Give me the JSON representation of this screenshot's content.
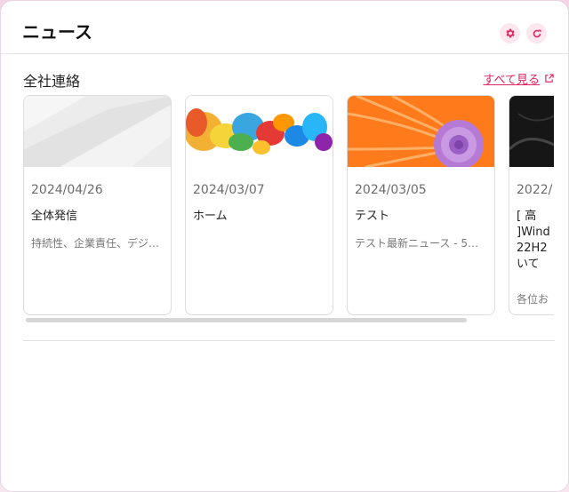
{
  "header": {
    "title": "ニュース",
    "settings_icon": "gear-icon",
    "refresh_icon": "refresh-icon"
  },
  "section": {
    "title": "全社連絡",
    "see_all": "すべて見る",
    "see_all_icon": "external-link-icon"
  },
  "colors": {
    "accent": "#e0245e",
    "icon_bg": "#fde7ef"
  },
  "cards": [
    {
      "date": "2024/04/26",
      "title": "全体発信",
      "summary": "持続性、企業責任、デジ…",
      "thumb": "gray-abstract"
    },
    {
      "date": "2024/03/07",
      "title": "ホーム",
      "summary": "",
      "thumb": "colorful-ink"
    },
    {
      "date": "2024/03/05",
      "title": "テスト",
      "summary": "テスト最新ニュース - 5…",
      "thumb": "orange-shell"
    },
    {
      "date": "2022/",
      "title_lines": [
        "[ 高",
        "]Wind",
        "22H2",
        "いて"
      ],
      "summary": "各位お",
      "thumb": "dark-abstract"
    }
  ]
}
